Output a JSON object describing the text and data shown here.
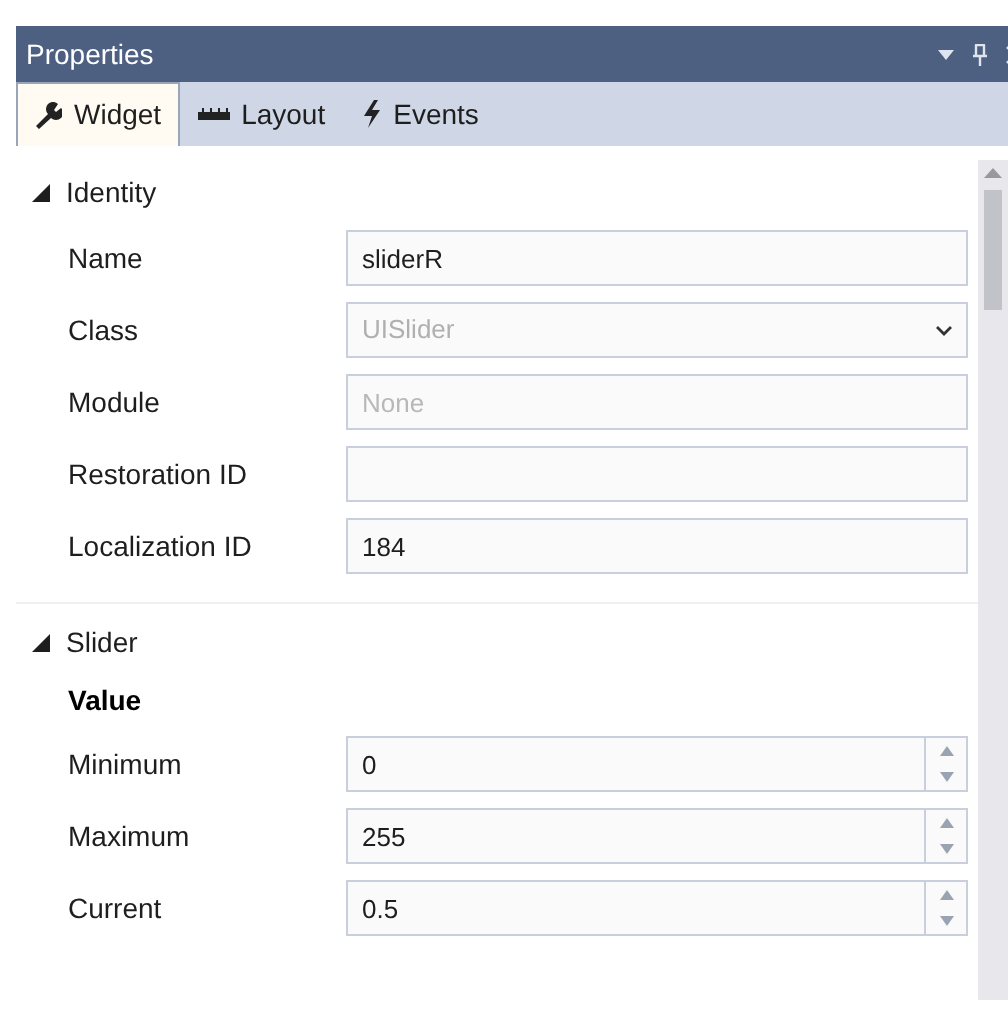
{
  "window": {
    "title": "Properties"
  },
  "tabs": [
    {
      "label": "Widget",
      "kind": "wrench",
      "selected": true
    },
    {
      "label": "Layout",
      "kind": "ruler",
      "selected": false
    },
    {
      "label": "Events",
      "kind": "bolt",
      "selected": false
    }
  ],
  "sections": [
    {
      "title": "Identity",
      "expanded": true,
      "rows": [
        {
          "kind": "text",
          "label": "Name",
          "value": "sliderR"
        },
        {
          "kind": "dropdown",
          "label": "Class",
          "value": "UISlider",
          "disabled": true
        },
        {
          "kind": "text",
          "label": "Module",
          "placeholder": "None"
        },
        {
          "kind": "text",
          "label": "Restoration ID"
        },
        {
          "kind": "text",
          "label": "Localization ID",
          "value": "184"
        }
      ]
    },
    {
      "title": "Slider",
      "expanded": true,
      "rows": [
        {
          "kind": "heading",
          "label": "Value"
        },
        {
          "kind": "spinner",
          "label": "Minimum",
          "value": "0"
        },
        {
          "kind": "spinner",
          "label": "Maximum",
          "value": "255"
        },
        {
          "kind": "spinner",
          "label": "Current",
          "value": "0.5"
        }
      ]
    }
  ]
}
